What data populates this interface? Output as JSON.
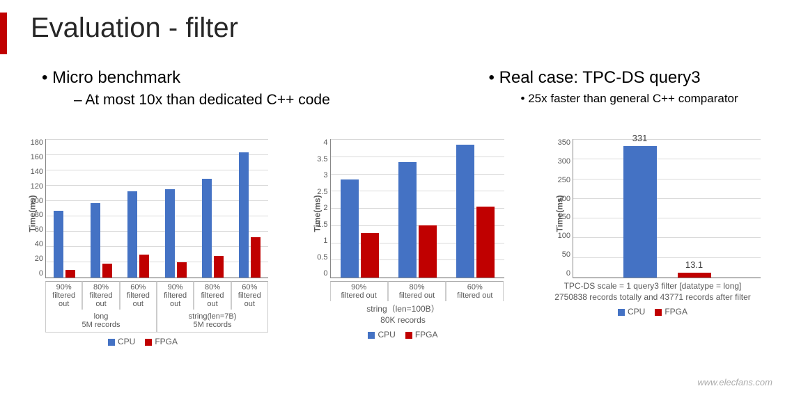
{
  "slide": {
    "title": "Evaluation - filter",
    "left": {
      "heading": "Micro benchmark",
      "sub": "At most 10x than dedicated C++ code"
    },
    "right": {
      "heading": "Real case: TPC-DS query3",
      "sub": "25x faster than general C++ comparator"
    }
  },
  "colors": {
    "cpu": "#4472c4",
    "fpga": "#c00000"
  },
  "legend": {
    "cpu": "CPU",
    "fpga": "FPGA"
  },
  "watermark": "www.elecfans.com",
  "chart_data": [
    {
      "type": "bar",
      "ylabel": "Time(ms)",
      "ylim": [
        0,
        180
      ],
      "yticks": [
        180,
        160,
        140,
        120,
        100,
        80,
        60,
        40,
        20,
        0
      ],
      "groups": [
        {
          "group_label": "long 5M records",
          "categories": [
            {
              "label": "90% filtered out",
              "CPU": 86,
              "FPGA": 10
            },
            {
              "label": "80% filtered out",
              "CPU": 96,
              "FPGA": 18
            },
            {
              "label": "60% filtered out",
              "CPU": 112,
              "FPGA": 30
            }
          ]
        },
        {
          "group_label": "string(len=7B) 5M records",
          "categories": [
            {
              "label": "90% filtered out",
              "CPU": 114,
              "FPGA": 20
            },
            {
              "label": "80% filtered out",
              "CPU": 128,
              "FPGA": 28
            },
            {
              "label": "60% filtered out",
              "CPU": 162,
              "FPGA": 52
            }
          ]
        }
      ],
      "series_names": [
        "CPU",
        "FPGA"
      ]
    },
    {
      "type": "bar",
      "ylabel": "Time(ms)",
      "ylim": [
        0,
        4
      ],
      "yticks": [
        4,
        3.5,
        3,
        2.5,
        2,
        1.5,
        1,
        0.5,
        0
      ],
      "subtitle": "string（len=100B）\n80K records",
      "categories": [
        "90% filtered out",
        "80% filtered out",
        "60% filtered out"
      ],
      "series": [
        {
          "name": "CPU",
          "values": [
            2.82,
            3.32,
            3.82
          ]
        },
        {
          "name": "FPGA",
          "values": [
            1.28,
            1.5,
            2.05
          ]
        }
      ]
    },
    {
      "type": "bar",
      "ylabel": "Time(ms)",
      "ylim": [
        0,
        350
      ],
      "yticks": [
        350,
        300,
        250,
        200,
        150,
        100,
        50,
        0
      ],
      "categories": [
        ""
      ],
      "series": [
        {
          "name": "CPU",
          "values": [
            331
          ],
          "label": "331"
        },
        {
          "name": "FPGA",
          "values": [
            13.1
          ],
          "label": "13.1"
        }
      ],
      "subtitle": "TPC-DS scale = 1 query3 filter [datatype = long]\n2750838 records totally and 43771 records after filter"
    }
  ]
}
